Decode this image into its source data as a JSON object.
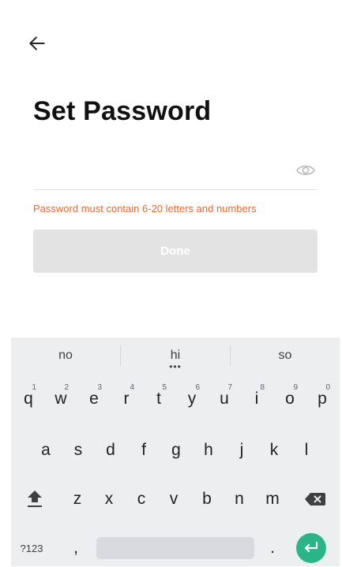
{
  "header": {
    "back_icon": "arrow-left-icon"
  },
  "page": {
    "title": "Set Password"
  },
  "password": {
    "value": "",
    "placeholder": "",
    "toggle_icon": "eye-icon",
    "hint": "Password must contain 6-20 letters and numbers",
    "hint_color": "#e8672d"
  },
  "actions": {
    "done_label": "Done"
  },
  "keyboard": {
    "suggestions": [
      "no",
      "hi",
      "so"
    ],
    "row1": [
      {
        "key": "q",
        "hint": "1"
      },
      {
        "key": "w",
        "hint": "2"
      },
      {
        "key": "e",
        "hint": "3"
      },
      {
        "key": "r",
        "hint": "4"
      },
      {
        "key": "t",
        "hint": "5"
      },
      {
        "key": "y",
        "hint": "6"
      },
      {
        "key": "u",
        "hint": "7"
      },
      {
        "key": "i",
        "hint": "8"
      },
      {
        "key": "o",
        "hint": "9"
      },
      {
        "key": "p",
        "hint": "0"
      }
    ],
    "row2": [
      "a",
      "s",
      "d",
      "f",
      "g",
      "h",
      "j",
      "k",
      "l"
    ],
    "row3": [
      "z",
      "x",
      "c",
      "v",
      "b",
      "n",
      "m"
    ],
    "symbols_label": "?123",
    "comma": ",",
    "period": ".",
    "shift_icon": "shift-icon",
    "backspace_icon": "backspace-icon",
    "enter_icon": "enter-icon",
    "enter_color": "#2bb38a"
  }
}
